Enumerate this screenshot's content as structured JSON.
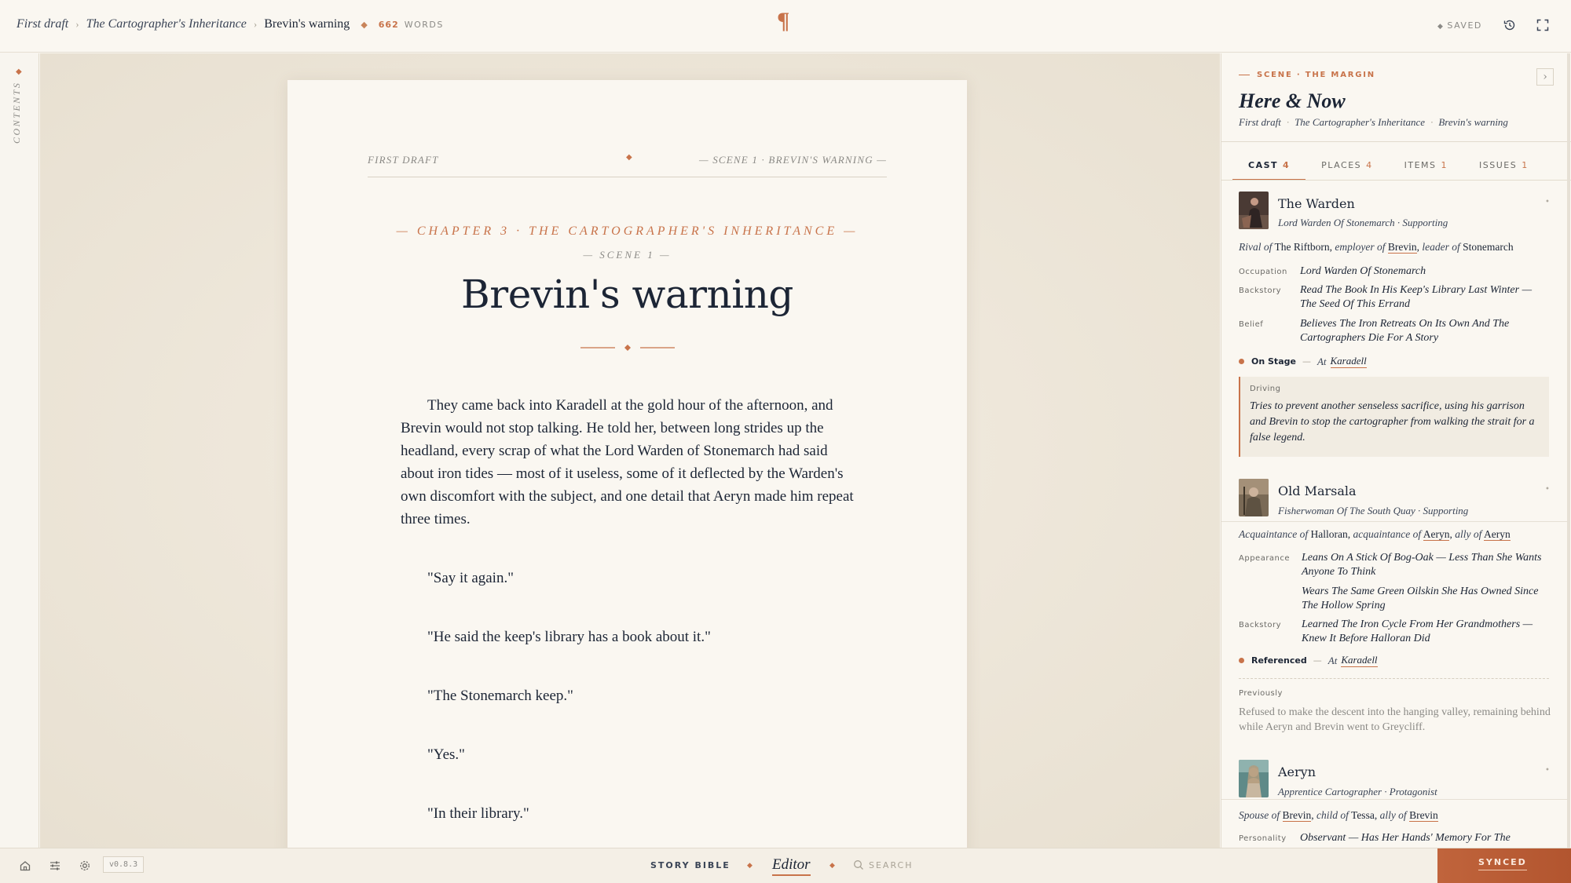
{
  "topbar": {
    "breadcrumb": [
      "First draft",
      "The Cartographer's Inheritance",
      "Brevin's warning"
    ],
    "word_count": "662",
    "word_label": "WORDS",
    "saved": "SAVED"
  },
  "left_rail": {
    "label": "CONTENTS"
  },
  "page": {
    "running_head_left": "FIRST DRAFT",
    "running_head_right": "— SCENE 1 · BREVIN'S WARNING —",
    "chapter": "— CHAPTER 3 · THE CARTOGRAPHER'S INHERITANCE —",
    "scene": "— SCENE 1 —",
    "title": "Brevin's warning",
    "paragraphs": [
      "They came back into Karadell at the gold hour of the afternoon, and Brevin would not stop talking. He told her, between long strides up the headland, every scrap of what the Lord Warden of Stonemarch had said about iron tides — most of it useless, some of it deflected by the Warden's own discomfort with the subject, and one detail that Aeryn made him repeat three times.",
      "\"Say it again.\"",
      "\"He said the keep's library has a book about it.\"",
      "\"The Stonemarch keep.\"",
      "\"Yes.\"",
      "\"In their library.\""
    ]
  },
  "panel": {
    "kicker": "SCENE · THE MARGIN",
    "title": "Here & Now",
    "crumbs": [
      "First draft",
      "The Cartographer's Inheritance",
      "Brevin's warning"
    ],
    "tabs": [
      {
        "label": "CAST",
        "count": "4"
      },
      {
        "label": "PLACES",
        "count": "4"
      },
      {
        "label": "ITEMS",
        "count": "1"
      },
      {
        "label": "ISSUES",
        "count": "1"
      }
    ],
    "cast": [
      {
        "name": "The Warden",
        "subtitle": "Lord Warden Of Stonemarch · Supporting",
        "relations": [
          {
            "type": "Rival of",
            "target": "The Riftborn",
            "linked": false
          },
          {
            "type": "employer of",
            "target": "Brevin",
            "linked": true
          },
          {
            "type": "leader of",
            "target": "Stonemarch",
            "linked": false
          }
        ],
        "fields": [
          {
            "label": "Occupation",
            "value": "Lord Warden Of Stonemarch"
          },
          {
            "label": "Backstory",
            "value": "Read The Book In His Keep's Library Last Winter — The Seed Of This Errand"
          },
          {
            "label": "Belief",
            "value": "Believes The Iron Retreats On Its Own And The Cartographers Die For A Story"
          }
        ],
        "status": "On Stage",
        "at": "At",
        "place": "Karadell",
        "driving_label": "Driving",
        "driving": "Tries to prevent another senseless sacrifice, using his garrison and Brevin to stop the cartographer from walking the strait for a false legend."
      },
      {
        "name": "Old Marsala",
        "subtitle": "Fisherwoman Of The South Quay · Supporting",
        "relations": [
          {
            "type": "Acquaintance of",
            "target": "Halloran",
            "linked": false
          },
          {
            "type": "acquaintance of",
            "target": "Aeryn",
            "linked": true
          },
          {
            "type": "ally of",
            "target": "Aeryn",
            "linked": true
          }
        ],
        "fields": [
          {
            "label": "Appearance",
            "value": "Leans On A Stick Of Bog-Oak — Less Than She Wants Anyone To Think"
          },
          {
            "label": "",
            "value": "Wears The Same Green Oilskin She Has Owned Since The Hollow Spring"
          },
          {
            "label": "Backstory",
            "value": "Learned The Iron Cycle From Her Grandmothers — Knew It Before Halloran Did"
          }
        ],
        "status": "Referenced",
        "at": "At",
        "place": "Karadell",
        "previously_label": "Previously",
        "previously": "Refused to make the descent into the hanging valley, remaining behind while Aeryn and Brevin went to Greycliff."
      },
      {
        "name": "Aeryn",
        "subtitle": "Apprentice Cartographer · Protagonist",
        "relations": [
          {
            "type": "Spouse of",
            "target": "Brevin",
            "linked": true
          },
          {
            "type": "child of",
            "target": "Tessa",
            "linked": false
          },
          {
            "type": "ally of",
            "target": "Brevin",
            "linked": true
          }
        ],
        "fields": [
          {
            "label": "Personality",
            "value": "Observant — Has Her Hands' Memory For The"
          }
        ]
      }
    ]
  },
  "bottombar": {
    "version": "v0.8.3",
    "story_bible": "STORY BIBLE",
    "editor": "Editor",
    "search": "SEARCH",
    "synced": "SYNCED"
  },
  "colors": {
    "accent": "#c8734a",
    "ink": "#1c2535",
    "paper": "#faf7f1",
    "synced_bg": "#b85a33"
  }
}
